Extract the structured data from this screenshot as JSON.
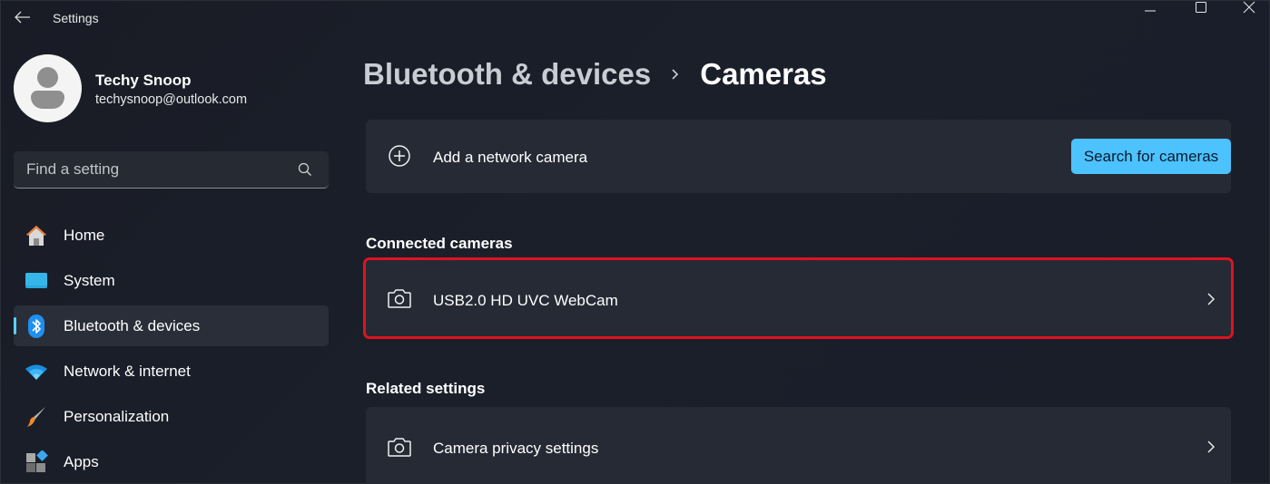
{
  "window": {
    "title": "Settings",
    "controls": {
      "minimize": "minimize",
      "maximize": "maximize",
      "close": "close"
    }
  },
  "profile": {
    "name": "Techy Snoop",
    "email": "techysnoop@outlook.com"
  },
  "search": {
    "placeholder": "Find a setting",
    "value": ""
  },
  "sidebar": {
    "items": [
      {
        "label": "Home",
        "icon": "home-icon",
        "active": false
      },
      {
        "label": "System",
        "icon": "system-icon",
        "active": false
      },
      {
        "label": "Bluetooth & devices",
        "icon": "bluetooth-icon",
        "active": true
      },
      {
        "label": "Network & internet",
        "icon": "wifi-icon",
        "active": false
      },
      {
        "label": "Personalization",
        "icon": "paintbrush-icon",
        "active": false
      },
      {
        "label": "Apps",
        "icon": "apps-icon",
        "active": false
      }
    ]
  },
  "breadcrumb": {
    "parent": "Bluetooth & devices",
    "separator": "chevron-right-icon",
    "current": "Cameras"
  },
  "main": {
    "add_camera": {
      "label": "Add a network camera",
      "icon": "add-circle-icon",
      "button_label": "Search for cameras"
    },
    "connected_section": {
      "title": "Connected cameras",
      "cameras": [
        {
          "label": "USB2.0 HD UVC WebCam",
          "icon": "camera-icon",
          "highlighted": true
        }
      ]
    },
    "related_section": {
      "title": "Related settings",
      "items": [
        {
          "label": "Camera privacy settings",
          "icon": "camera-icon"
        }
      ]
    }
  },
  "colors": {
    "accent": "#4cc2ff",
    "indicator": "#60cdff",
    "highlight": "#e01220",
    "background": "#1a1e28",
    "card": "#262a35"
  }
}
